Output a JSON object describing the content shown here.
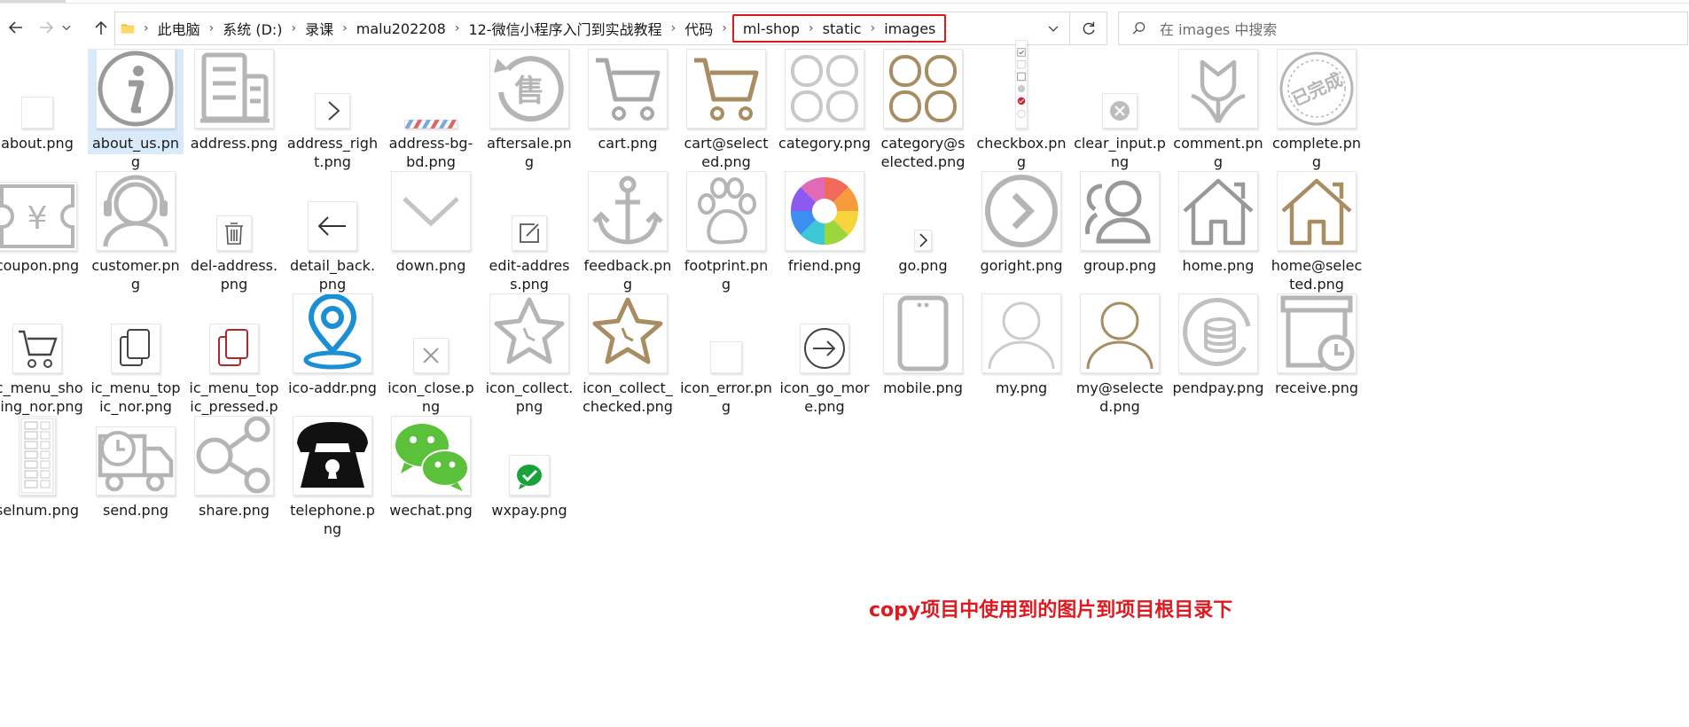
{
  "window": {
    "breadcrumb": [
      "此电脑",
      "系统 (D:)",
      "录课",
      "malu202208",
      "12-微信小程序入门到实战教程",
      "代码"
    ],
    "highlighted_path": [
      "ml-shop",
      "static",
      "images"
    ],
    "search_placeholder": "在 images 中搜索"
  },
  "files": [
    {
      "name": "about.png",
      "icon": "blank-square",
      "selected": false
    },
    {
      "name": "about_us.png",
      "icon": "info-circle",
      "selected": true
    },
    {
      "name": "address.png",
      "icon": "building",
      "selected": false
    },
    {
      "name": "address_right.png",
      "icon": "chevron-right",
      "selected": false
    },
    {
      "name": "address-bg-bd.png",
      "icon": "stripe-border",
      "selected": false
    },
    {
      "name": "aftersale.png",
      "icon": "aftersale-circle",
      "selected": false
    },
    {
      "name": "cart.png",
      "icon": "cart-gray",
      "selected": false
    },
    {
      "name": "cart@selected.png",
      "icon": "cart-gold",
      "selected": false
    },
    {
      "name": "category.png",
      "icon": "category-gray",
      "selected": false
    },
    {
      "name": "category@selected.png",
      "icon": "category-gold",
      "selected": false
    },
    {
      "name": "checkbox.png",
      "icon": "checkbox-sprite",
      "selected": false
    },
    {
      "name": "clear_input.png",
      "icon": "clear-circle",
      "selected": false
    },
    {
      "name": "comment.png",
      "icon": "tulip",
      "selected": false
    },
    {
      "name": "complete.png",
      "icon": "complete-stamp",
      "selected": false
    },
    {
      "name": "coupon.png",
      "icon": "coupon-yen",
      "selected": false
    },
    {
      "name": "customer.png",
      "icon": "headset-person",
      "selected": false
    },
    {
      "name": "del-address.png",
      "icon": "trash",
      "selected": false
    },
    {
      "name": "detail_back.png",
      "icon": "arrow-left",
      "selected": false
    },
    {
      "name": "down.png",
      "icon": "chevron-down",
      "selected": false
    },
    {
      "name": "edit-address.png",
      "icon": "edit-square",
      "selected": false
    },
    {
      "name": "feedback.png",
      "icon": "anchor",
      "selected": false
    },
    {
      "name": "footprint.png",
      "icon": "paw",
      "selected": false
    },
    {
      "name": "friend.png",
      "icon": "aperture",
      "selected": false
    },
    {
      "name": "go.png",
      "icon": "chevron-right-small",
      "selected": false
    },
    {
      "name": "goright.png",
      "icon": "chevron-right-circle",
      "selected": false
    },
    {
      "name": "group.png",
      "icon": "group-people",
      "selected": false
    },
    {
      "name": "home.png",
      "icon": "home-gray",
      "selected": false
    },
    {
      "name": "home@selected.png",
      "icon": "home-gold",
      "selected": false
    },
    {
      "name": "ic_menu_shoping_nor.png",
      "icon": "cart-dark",
      "selected": false
    },
    {
      "name": "ic_menu_topic_nor.png",
      "icon": "stack-dark",
      "selected": false
    },
    {
      "name": "ic_menu_topic_pressed.png",
      "icon": "stack-red",
      "selected": false
    },
    {
      "name": "ico-addr.png",
      "icon": "location-pin",
      "selected": false
    },
    {
      "name": "icon_close.png",
      "icon": "close-x",
      "selected": false
    },
    {
      "name": "icon_collect.png",
      "icon": "star-gray",
      "selected": false
    },
    {
      "name": "icon_collect_checked.png",
      "icon": "star-gold",
      "selected": false
    },
    {
      "name": "icon_error.png",
      "icon": "blank-square",
      "selected": false
    },
    {
      "name": "icon_go_more.png",
      "icon": "arrow-right-circle",
      "selected": false
    },
    {
      "name": "mobile.png",
      "icon": "phone-device",
      "selected": false
    },
    {
      "name": "my.png",
      "icon": "person-gray",
      "selected": false
    },
    {
      "name": "my@selected.png",
      "icon": "person-gold",
      "selected": false
    },
    {
      "name": "pendpay.png",
      "icon": "coins-circle",
      "selected": false
    },
    {
      "name": "receive.png",
      "icon": "box-clock",
      "selected": false
    },
    {
      "name": "selnum.png",
      "icon": "selnum-sprite",
      "selected": false
    },
    {
      "name": "send.png",
      "icon": "truck-clock",
      "selected": false
    },
    {
      "name": "share.png",
      "icon": "share-nodes",
      "selected": false
    },
    {
      "name": "telephone.png",
      "icon": "telephone",
      "selected": false
    },
    {
      "name": "wechat.png",
      "icon": "wechat-logo",
      "selected": false
    },
    {
      "name": "wxpay.png",
      "icon": "wxpay-logo",
      "selected": false
    }
  ],
  "annotation": "copy项目中使用到的图片到项目根目录下",
  "colors": {
    "accent_red": "#e0191f",
    "selection": "#d9ebfb",
    "gray_icon": "#b5b5b5",
    "gold_icon": "#a88d63",
    "blue_pin": "#1a8fd6"
  }
}
